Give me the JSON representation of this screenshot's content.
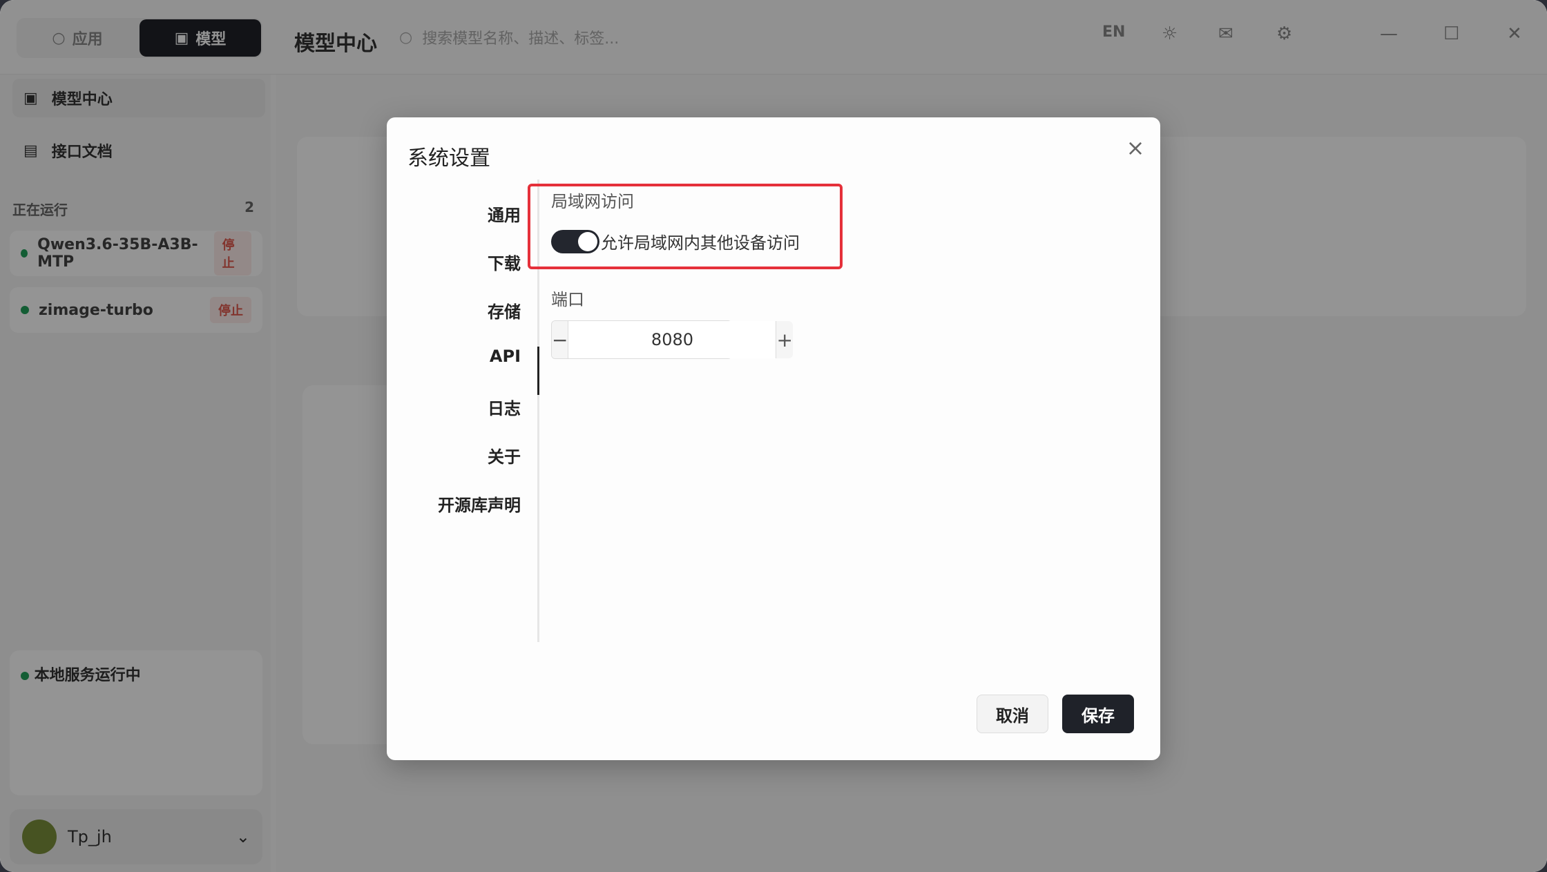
{
  "app": {
    "segments": [
      "应用",
      "模型"
    ],
    "active_segment": "模型",
    "title": "模型中心",
    "search_placeholder": "搜索模型名称、描述、标签...",
    "lang": "EN"
  },
  "sidebar": {
    "items": [
      {
        "label": "模型中心",
        "icon": "cube-icon"
      },
      {
        "label": "接口文档",
        "icon": "doc-icon"
      }
    ],
    "running_title": "正在运行",
    "running_count": "2",
    "running": [
      {
        "name": "Qwen3.6-35B-A3B-MTP",
        "action": "停止"
      },
      {
        "name": "zimage-turbo",
        "action": "停止"
      }
    ],
    "service_status": "本地服务运行中",
    "user": "Tp_jh"
  },
  "modal": {
    "title": "系统设置",
    "nav": [
      "通用",
      "下载",
      "存储",
      "API",
      "日志",
      "关于",
      "开源库声明"
    ],
    "active_nav": "API",
    "lan_section_label": "局域网访问",
    "lan_toggle_label": "允许局域网内其他设备访问",
    "lan_enabled": true,
    "port_label": "端口",
    "port_value": "8080",
    "cancel_label": "取消",
    "save_label": "保存"
  },
  "colors": {
    "accent_dark": "#1f2229",
    "highlight_red": "#e5303a",
    "status_green": "#22a05a"
  }
}
